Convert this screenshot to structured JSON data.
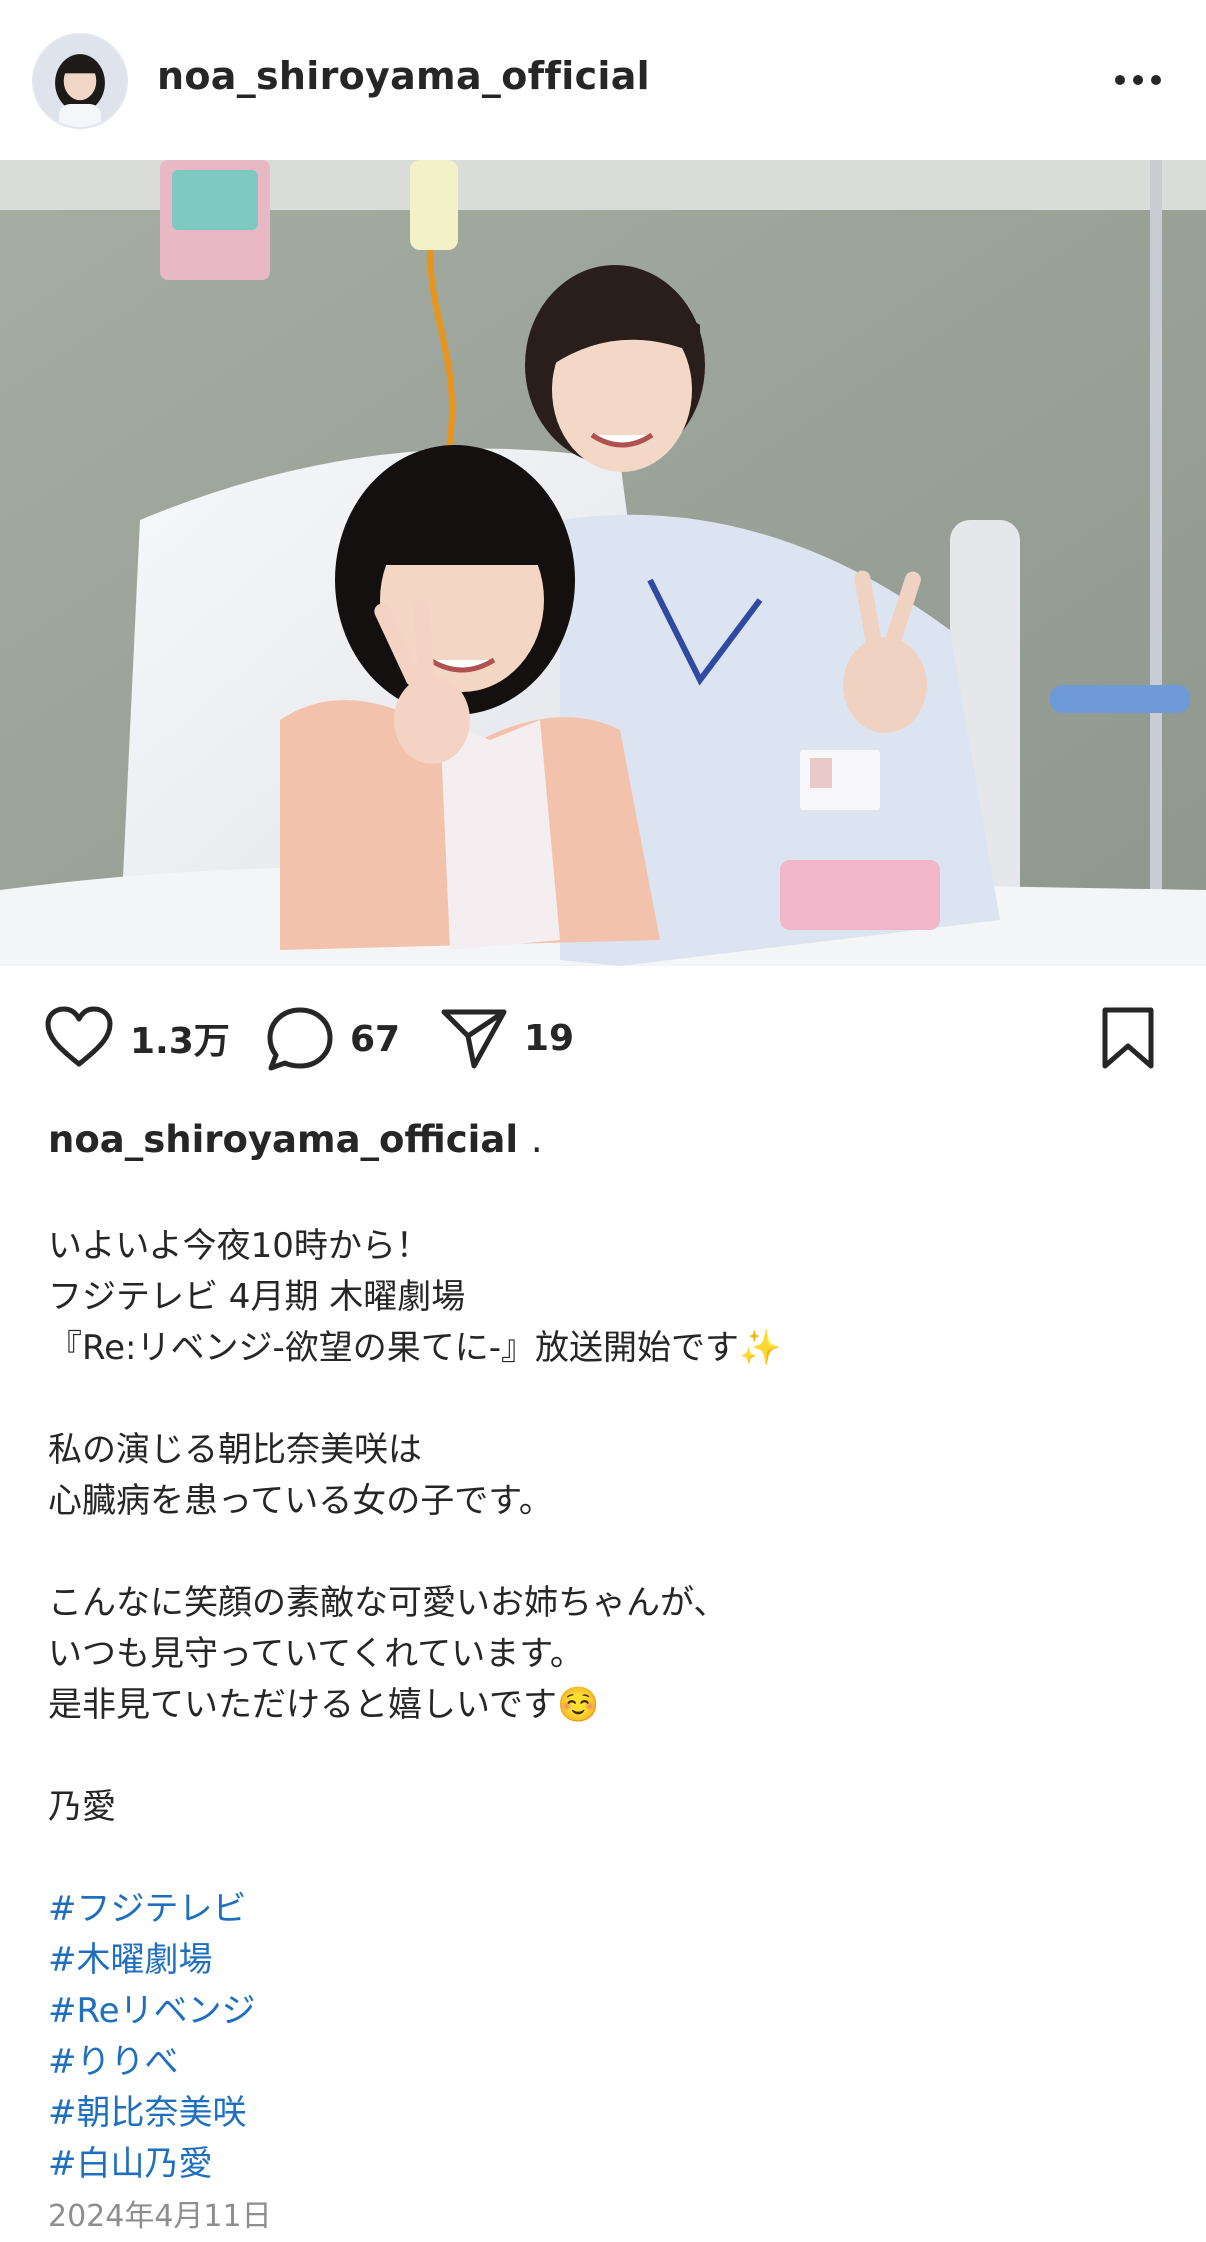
{
  "header": {
    "username": "noa_shiroyama_official",
    "more_icon": "more-horizontal-icon"
  },
  "post": {
    "image_icon": "post-photo"
  },
  "actions": {
    "likes": "1.3万",
    "comments": "67",
    "shares": "19",
    "icons": [
      "heart-icon",
      "comment-icon",
      "send-icon",
      "bookmark-icon"
    ]
  },
  "caption": {
    "username": "noa_shiroyama_official",
    "dot": ".",
    "lines": [
      "いよいよ今夜10時から！",
      "フジテレビ 4月期 木曜劇場",
      "『Re:リベンジ-欲望の果てに-』放送開始です✨",
      "私の演じる朝比奈美咲は",
      "心臓病を患っている女の子です。",
      "こんなに笑顔の素敵な可愛いお姉ちゃんが、",
      "いつも見守っていてくれています。",
      "是非見ていただけると嬉しいです☺️",
      "乃愛"
    ],
    "hashtags": [
      "#フジテレビ",
      "#木曜劇場",
      "#Reリベンジ",
      "#りりべ",
      "#朝比奈美咲",
      "#白山乃愛"
    ],
    "date": "2024年4月11日"
  },
  "colors": {
    "text": "#262626",
    "hashtag": "#1f6fbf",
    "muted": "#8e8e8e"
  }
}
